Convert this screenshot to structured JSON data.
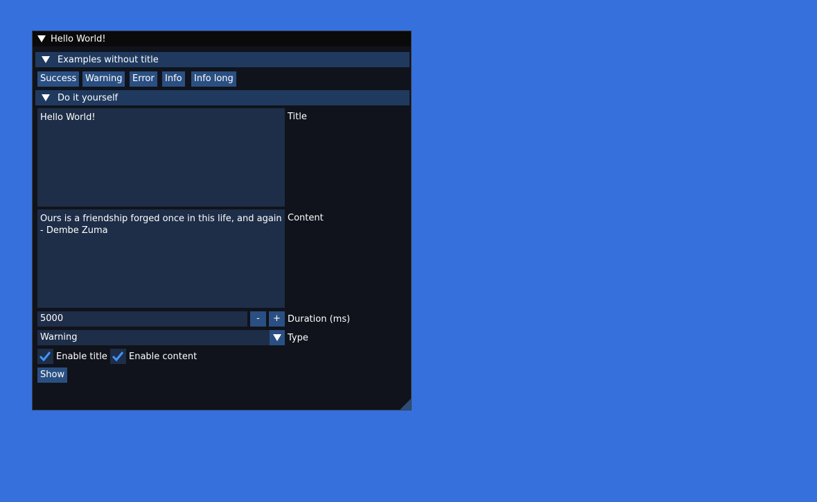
{
  "window": {
    "title": "Hello World!"
  },
  "examples": {
    "header": "Examples without title",
    "buttons": [
      "Success",
      "Warning",
      "Error",
      "Info",
      "Info long"
    ]
  },
  "diy": {
    "header": "Do it yourself",
    "title_value": "Hello World!",
    "title_label": "Title",
    "content_value": "Ours is a friendship forged once in this life, and again in\n- Dembe Zuma",
    "content_label": "Content",
    "duration_value": "5000",
    "duration_minus": "-",
    "duration_plus": "+",
    "duration_label": "Duration (ms)",
    "type_value": "Warning",
    "type_label": "Type",
    "enable_title_label": "Enable title",
    "enable_title_checked": true,
    "enable_content_label": "Enable content",
    "enable_content_checked": true,
    "show_label": "Show"
  },
  "colors": {
    "background": "#3570DC",
    "window_bg": "#10131B",
    "titlebar_bg": "#0A0A0A",
    "header_bg": "#203A5F",
    "button_bg": "#2A4F82",
    "field_bg": "#1E2E48",
    "check_color": "#4296FA"
  }
}
